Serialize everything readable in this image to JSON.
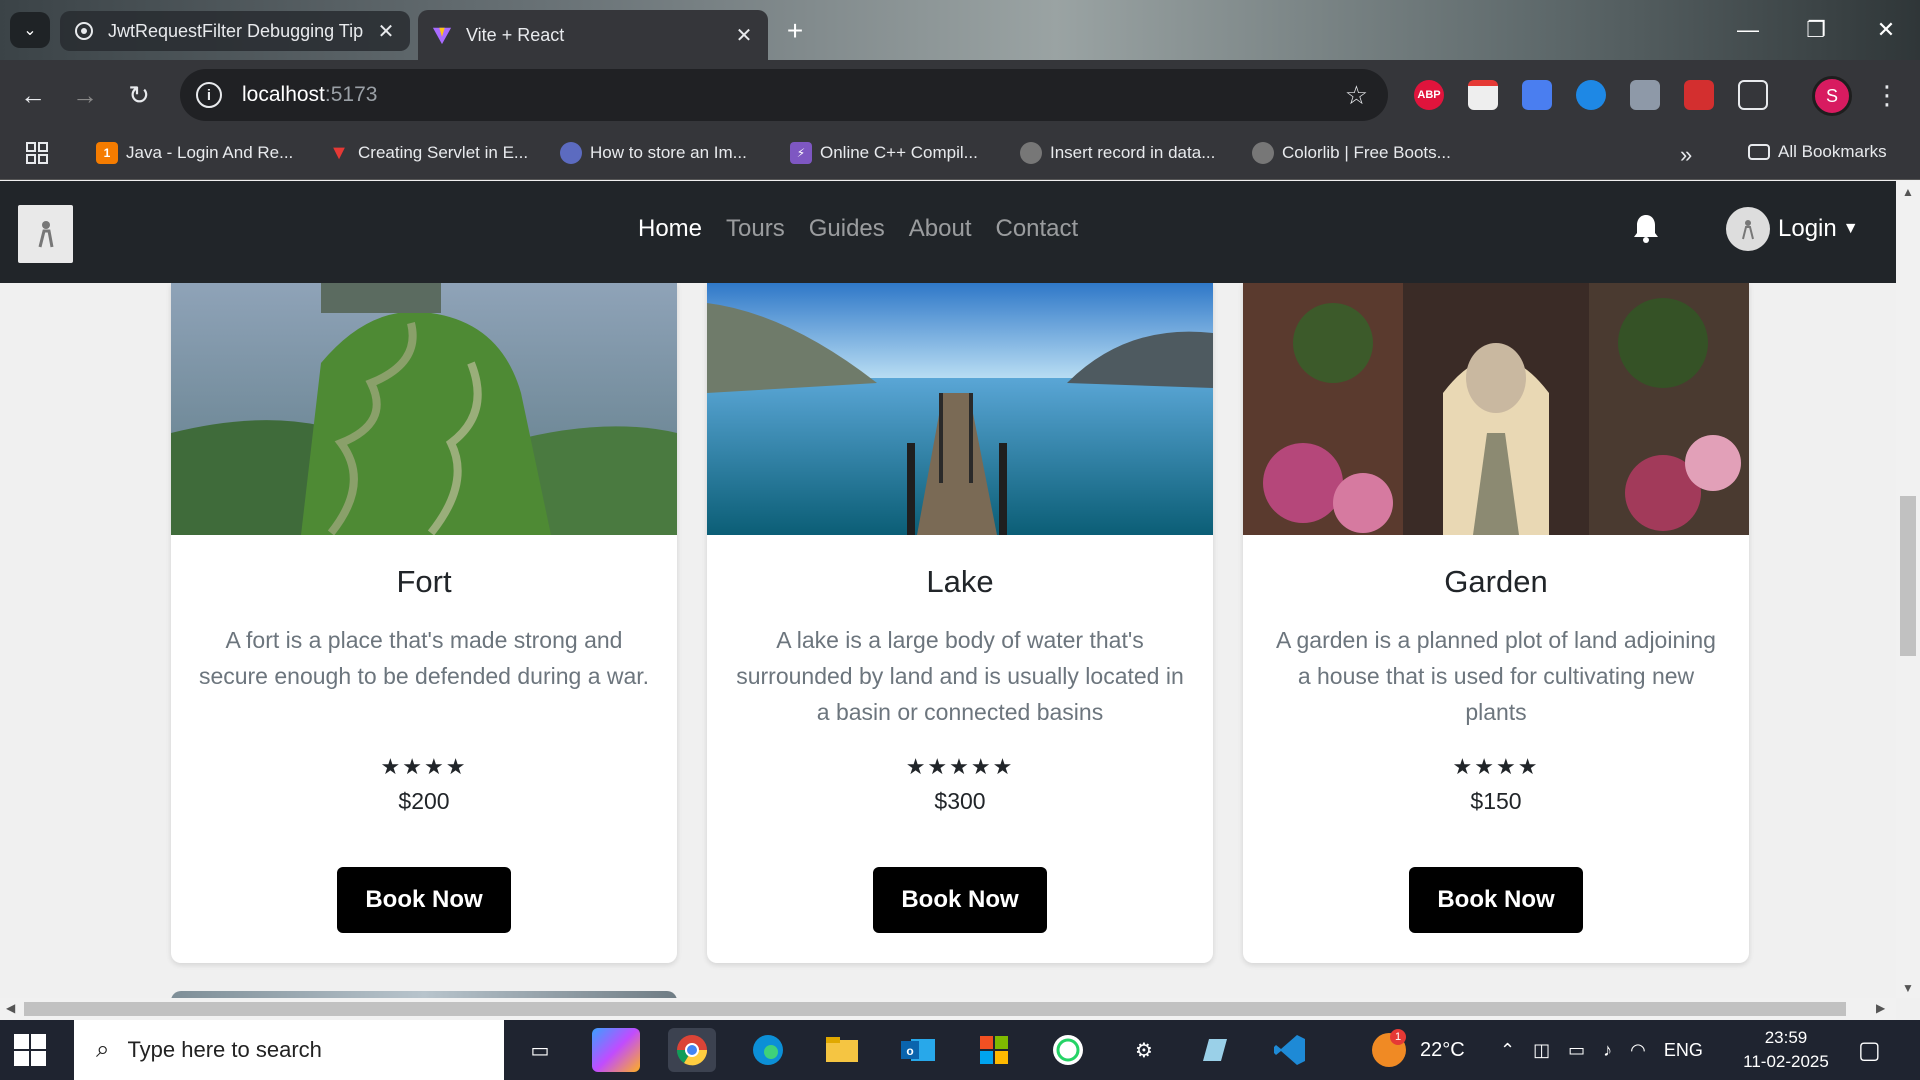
{
  "browser": {
    "tabs": [
      {
        "title": "JwtRequestFilter Debugging Tip",
        "active": false
      },
      {
        "title": "Vite + React",
        "active": true
      }
    ],
    "new_tab_label": "+",
    "address": {
      "host": "localhost",
      "port": ":5173"
    },
    "profile_initial": "S",
    "extensions": [
      "ABP",
      "",
      "",
      "",
      "",
      "",
      ""
    ],
    "bookmarks": [
      "Java - Login And Re...",
      "Creating Servlet in E...",
      "How to store an Im...",
      "Online C++ Compil...",
      "Insert record in data...",
      "Colorlib | Free Boots..."
    ],
    "overflow_label": "»",
    "all_bookmarks": "All Bookmarks"
  },
  "navbar": {
    "links": [
      {
        "label": "Home",
        "active": true
      },
      {
        "label": "Tours",
        "active": false
      },
      {
        "label": "Guides",
        "active": false
      },
      {
        "label": "About",
        "active": false
      },
      {
        "label": "Contact",
        "active": false
      }
    ],
    "login_label": "Login"
  },
  "cards": [
    {
      "title": "Fort",
      "description": "A fort is a place that's made strong and secure enough to be defended during a war.",
      "stars": "★★★★",
      "rating": 4,
      "price": "$200",
      "button": "Book Now"
    },
    {
      "title": "Lake",
      "description": "A lake is a large body of water that's surrounded by land and is usually located in a basin or connected basins",
      "stars": "★★★★★",
      "rating": 5,
      "price": "$300",
      "button": "Book Now"
    },
    {
      "title": "Garden",
      "description": "A garden is a planned plot of land adjoining a house that is used for cultivating new plants",
      "stars": "★★★★",
      "rating": 4,
      "price": "$150",
      "button": "Book Now"
    }
  ],
  "taskbar": {
    "search_placeholder": "Type here to search",
    "weather": "22°C",
    "weather_badge": "1",
    "language": "ENG",
    "time": "23:59",
    "date": "11-02-2025"
  },
  "colors": {
    "navbar_bg": "#212529",
    "button_bg": "#000000",
    "profile": "#d81b60"
  }
}
